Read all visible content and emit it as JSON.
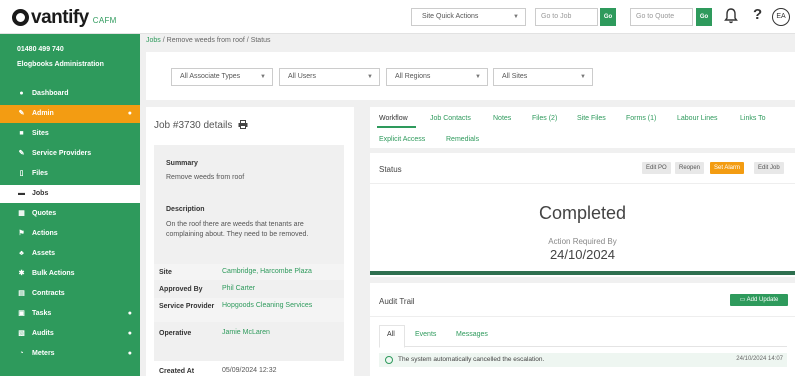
{
  "brand": {
    "name": "vantify",
    "product": "CAFM"
  },
  "header": {
    "quick_actions": "Site Quick Actions",
    "goto_job_placeholder": "Go to Job",
    "goto_quote_placeholder": "Go to Quote",
    "go_label": "Go",
    "avatar_initials": "EA"
  },
  "sidebar": {
    "phone": "01480 499 740",
    "account": "Elogbooks Administration",
    "items": [
      {
        "label": "Dashboard",
        "icon": "dashboard-icon"
      },
      {
        "label": "Admin",
        "icon": "wrench-icon",
        "chevron": true,
        "state": "active"
      },
      {
        "label": "Sites",
        "icon": "building-icon"
      },
      {
        "label": "Service Providers",
        "icon": "wrench-icon"
      },
      {
        "label": "Files",
        "icon": "file-icon"
      },
      {
        "label": "Jobs",
        "icon": "briefcase-icon",
        "state": "selected"
      },
      {
        "label": "Quotes",
        "icon": "calculator-icon"
      },
      {
        "label": "Actions",
        "icon": "flag-icon"
      },
      {
        "label": "Assets",
        "icon": "cubes-icon"
      },
      {
        "label": "Bulk Actions",
        "icon": "cog-icon"
      },
      {
        "label": "Contracts",
        "icon": "document-icon"
      },
      {
        "label": "Tasks",
        "icon": "calendar-icon",
        "chevron": true
      },
      {
        "label": "Audits",
        "icon": "clipboard-icon",
        "chevron": true
      },
      {
        "label": "Meters",
        "icon": "gauge-icon",
        "chevron": true
      }
    ]
  },
  "breadcrumb": {
    "jobs": "Jobs",
    "job": "Remove weeds from roof",
    "current": "Status",
    "sep": " / "
  },
  "filters": [
    "All Associate Types",
    "All Users",
    "All Regions",
    "All Sites"
  ],
  "job": {
    "title": "Job #3730 details",
    "summary_label": "Summary",
    "summary": "Remove weeds from roof",
    "description_label": "Description",
    "description": "On the roof there are weeds that tenants are complaining about. They need to be removed.",
    "fields": [
      {
        "key": "Site",
        "value": "Cambridge, Harcombe Plaza"
      },
      {
        "key": "Approved By",
        "value": "Phil Carter"
      },
      {
        "key": "Service Provider",
        "value": "Hopgoods Cleaning Services"
      },
      {
        "key": "Operative",
        "value": "Jamie McLaren"
      },
      {
        "key": "Created At",
        "value": "05/09/2024 12:32"
      }
    ]
  },
  "workflow_tabs": {
    "row1": [
      "Workflow",
      "Job Contacts",
      "Notes",
      "Files (2)",
      "Site Files",
      "Forms (1)",
      "Labour Lines",
      "Links To"
    ],
    "row2": [
      "Explicit Access",
      "Remedials"
    ]
  },
  "status": {
    "title": "Status",
    "buttons": [
      "Edit PO",
      "Reopen",
      "Set Alarm",
      "Edit Job"
    ],
    "state": "Completed",
    "action_required_label": "Action Required By",
    "action_required_date": "24/10/2024"
  },
  "audit": {
    "title": "Audit Trail",
    "add_update": "Add Update",
    "tabs": [
      "All",
      "Events",
      "Messages"
    ],
    "entries": [
      {
        "message": "The system automatically cancelled the escalation.",
        "timestamp": "24/10/2024 14:07"
      }
    ]
  },
  "colors": {
    "primary": "#2e9a5c",
    "accent": "#f39c12",
    "dark_green": "#2e6f4f"
  }
}
